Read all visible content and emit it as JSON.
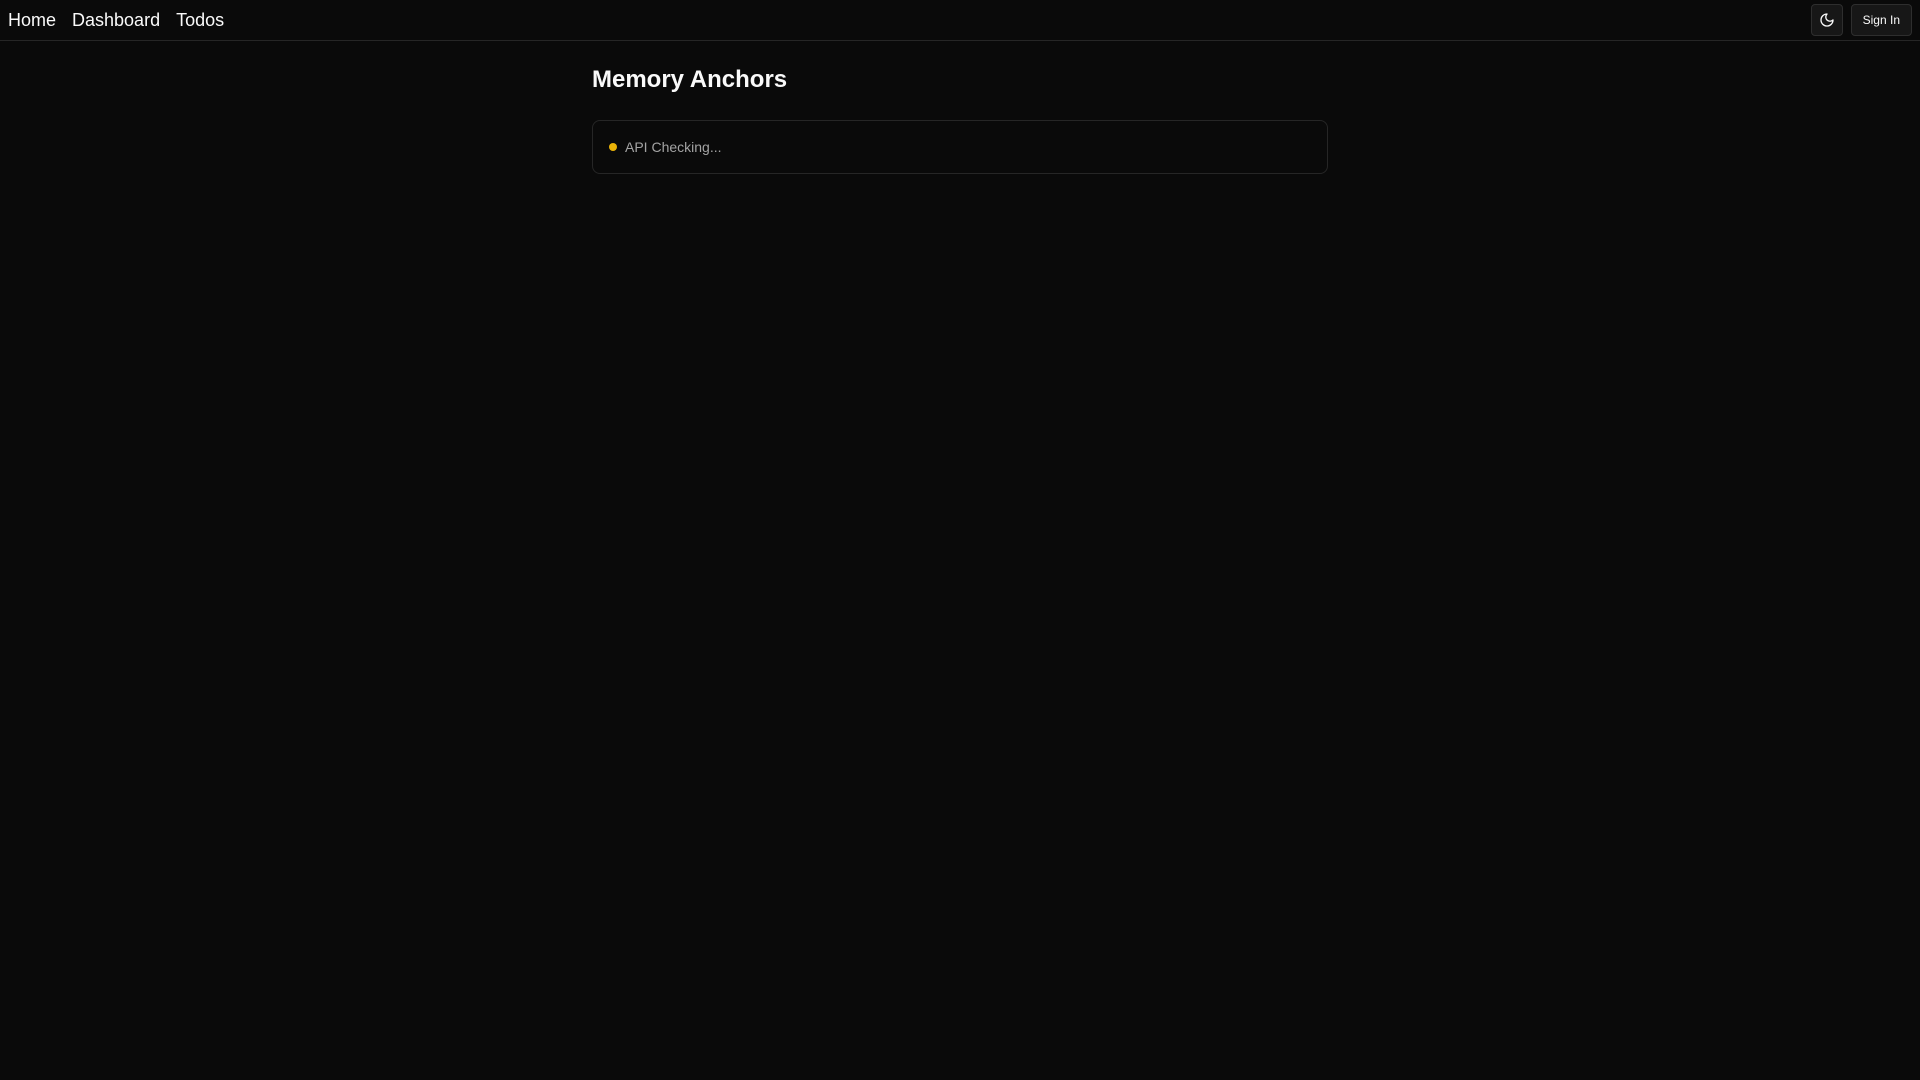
{
  "nav": {
    "items": [
      {
        "label": "Home"
      },
      {
        "label": "Dashboard"
      },
      {
        "label": "Todos"
      }
    ]
  },
  "header": {
    "theme_toggle_icon": "moon-icon",
    "sign_in_label": "Sign In"
  },
  "main": {
    "title": "Memory Anchors",
    "status": {
      "text": "API Checking...",
      "dot_color": "#eab308"
    }
  },
  "colors": {
    "background": "#0a0a0a",
    "border": "#262626",
    "text": "#fafafa",
    "muted_text": "#a3a3a3",
    "status_pending": "#eab308"
  }
}
